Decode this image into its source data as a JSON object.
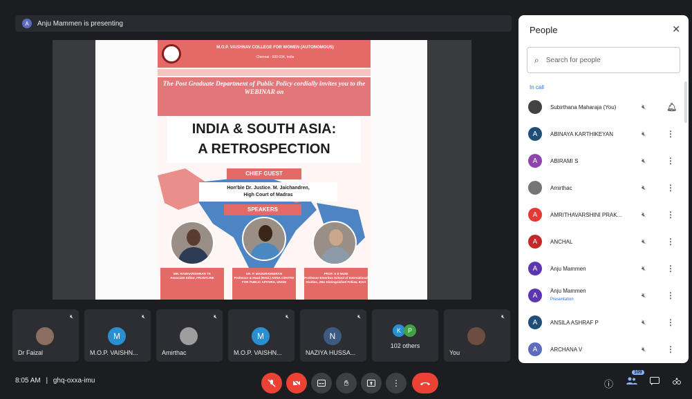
{
  "presenting": {
    "avatar_letter": "A",
    "text": "Anju Mammen is presenting"
  },
  "poster": {
    "college_line1": "M.O.P. VAISHNAV COLLEGE FOR WOMEN (AUTONOMOUS)",
    "college_line2": "Chennai - 600 034, India",
    "invite": "The Post Graduate Department of Public Policy cordially invites you to the WEBINAR on",
    "title_line1": "INDIA & SOUTH ASIA:",
    "title_line2": "A RETROSPECTION",
    "chief_guest_label": "CHIEF GUEST",
    "chief_guest_name": "Hon'ble Dr. Justice. M. Jaichandren,",
    "chief_guest_role": "High Court of Madras",
    "speakers_label": "SPEAKERS",
    "speakers": [
      {
        "name": "MR. RAMAKRISHNAN TK",
        "role": "Associate Editor, FRONTLINE"
      },
      {
        "name": "DR. P. MADURAVEERAN",
        "role": "Professor & Head (Retd.) ANNA CENTRE FOR PUBLIC AFFAIRS, UNOM"
      },
      {
        "name": "PROF. S D MUNI",
        "role": "Professor Emeritus School of International Studies, JNU Distinguished Fellow, IDSA"
      }
    ]
  },
  "tiles": [
    {
      "name": "Dr Faizal",
      "avatar": "",
      "color": "#8d6e63"
    },
    {
      "name": "M.O.P. VAISHN...",
      "avatar": "M",
      "color": "#2a8fd0"
    },
    {
      "name": "Amirthac",
      "avatar": "",
      "color": "#9e9e9e"
    },
    {
      "name": "M.O.P. VAISHN...",
      "avatar": "M",
      "color": "#2a8fd0"
    },
    {
      "name": "NAZIYA HUSSA...",
      "avatar": "N",
      "color": "#3c5a82"
    },
    {
      "name": "You",
      "avatar": "",
      "color": "#6d4c41"
    }
  ],
  "others": {
    "label": "102 others",
    "avatars": [
      "K",
      "P"
    ],
    "colors": [
      "#2a8fd0",
      "#43a047"
    ]
  },
  "bottom": {
    "time": "8:05 AM",
    "separator": "|",
    "meeting_code": "ghq-oxxa-imu",
    "people_count": "109"
  },
  "people_panel": {
    "title": "People",
    "search_placeholder": "Search for people",
    "section_label": "In call",
    "people": [
      {
        "name": "Subirthana Maharaja (You)",
        "avatar": "",
        "color": "#424242",
        "sub": ""
      },
      {
        "name": "ABINAYA KARTHIKEYAN",
        "avatar": "A",
        "color": "#1f4e79",
        "sub": ""
      },
      {
        "name": "ABIRAMI S",
        "avatar": "A",
        "color": "#8e44ad",
        "sub": ""
      },
      {
        "name": "Amirthac",
        "avatar": "",
        "color": "#757575",
        "sub": ""
      },
      {
        "name": "AMRITHAVARSHINI PRAK...",
        "avatar": "A",
        "color": "#e53935",
        "sub": ""
      },
      {
        "name": "ANCHAL",
        "avatar": "A",
        "color": "#c62828",
        "sub": ""
      },
      {
        "name": "Anju Mammen",
        "avatar": "A",
        "color": "#5e35b1",
        "sub": ""
      },
      {
        "name": "Anju Mammen",
        "avatar": "A",
        "color": "#5e35b1",
        "sub": "Presentation"
      },
      {
        "name": "ANSILA ASHRAF P",
        "avatar": "A",
        "color": "#1f4e79",
        "sub": ""
      },
      {
        "name": "ARCHANA V",
        "avatar": "A",
        "color": "#5c6bc0",
        "sub": ""
      }
    ]
  }
}
